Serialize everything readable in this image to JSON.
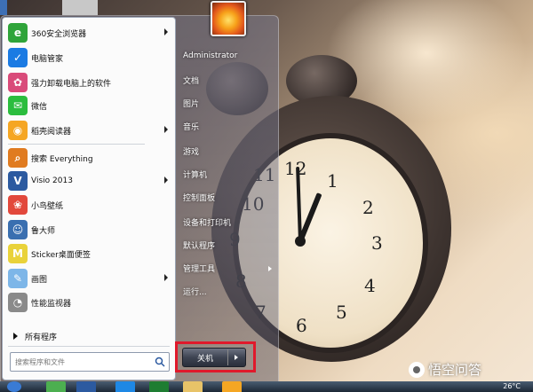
{
  "start_menu": {
    "programs": [
      {
        "label": "360安全浏览器",
        "icon": "360-browser-icon",
        "color": "#2fa43a",
        "glyph": "e",
        "has_submenu": true
      },
      {
        "label": "电脑管家",
        "icon": "pc-manager-icon",
        "color": "#1b7be3",
        "glyph": "✓",
        "has_submenu": false
      },
      {
        "label": "强力卸载电脑上的软件",
        "icon": "uninstaller-icon",
        "color": "#d94b7a",
        "glyph": "✿",
        "has_submenu": false
      },
      {
        "label": "微信",
        "icon": "wechat-icon",
        "color": "#2bbd3e",
        "glyph": "✉",
        "has_submenu": false
      },
      {
        "label": "稻壳阅读器",
        "icon": "docer-reader-icon",
        "color": "#f5a623",
        "glyph": "◉",
        "has_submenu": true
      },
      {
        "label": "搜索 Everything",
        "icon": "everything-search-icon",
        "color": "#e07b20",
        "glyph": "⌕",
        "has_submenu": false
      },
      {
        "label": "Visio 2013",
        "icon": "visio-icon",
        "color": "#2c5aa0",
        "glyph": "V",
        "has_submenu": true
      },
      {
        "label": "小鸟壁纸",
        "icon": "bird-wallpaper-icon",
        "color": "#e2483c",
        "glyph": "❀",
        "has_submenu": false
      },
      {
        "label": "鲁大师",
        "icon": "ludashi-icon",
        "color": "#3a6fb0",
        "glyph": "☺",
        "has_submenu": false
      },
      {
        "label": "Sticker桌面便签",
        "icon": "sticker-notes-icon",
        "color": "#e9d23a",
        "glyph": "M",
        "has_submenu": false
      },
      {
        "label": "画图",
        "icon": "paint-icon",
        "color": "#7db6e8",
        "glyph": "✎",
        "has_submenu": true
      },
      {
        "label": "性能监视器",
        "icon": "performance-monitor-icon",
        "color": "#8a8a8a",
        "glyph": "◔",
        "has_submenu": false
      }
    ],
    "all_programs": "所有程序",
    "search_placeholder": "搜索程序和文件",
    "right_items": [
      {
        "label": "Administrator",
        "has_submenu": false
      },
      {
        "label": "文档",
        "has_submenu": false
      },
      {
        "label": "图片",
        "has_submenu": false
      },
      {
        "label": "音乐",
        "has_submenu": false
      },
      {
        "label": "游戏",
        "has_submenu": false
      },
      {
        "label": "计算机",
        "has_submenu": false
      },
      {
        "label": "控制面板",
        "has_submenu": false
      },
      {
        "label": "设备和打印机",
        "has_submenu": false
      },
      {
        "label": "默认程序",
        "has_submenu": false
      },
      {
        "label": "管理工具",
        "has_submenu": true
      },
      {
        "label": "运行...",
        "has_submenu": false
      }
    ],
    "shutdown_label": "关机"
  },
  "taskbar": {
    "temperature": "26°C"
  },
  "watermark": {
    "text": "悟空问答"
  },
  "colors": {
    "highlight": "#e0192b",
    "accent": "#1b7be3"
  }
}
